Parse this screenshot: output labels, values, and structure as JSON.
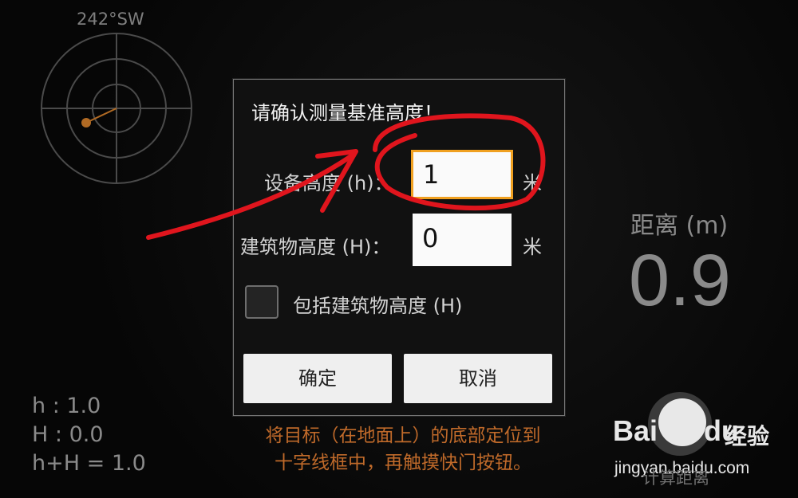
{
  "compass": {
    "heading": "242°SW"
  },
  "dialog": {
    "title": "请确认测量基准高度！",
    "device_height": {
      "label": "设备高度 (h)：",
      "value": "1",
      "unit": "米"
    },
    "building_height": {
      "label": "建筑物高度 (H)：",
      "value": "0",
      "unit": "米"
    },
    "include_building": {
      "label": "包括建筑物高度 (H)",
      "checked": false
    },
    "ok_label": "确定",
    "cancel_label": "取消"
  },
  "stats": {
    "h": "h : 1.0",
    "H": "H : 0.0",
    "sum": "h+H = 1.0"
  },
  "distance": {
    "label": "距离 (m)",
    "value": "0.9"
  },
  "instructions": {
    "line1": "将目标（在地面上）的底部定位到",
    "line2": "十字线框中，再触摸快门按钮。"
  },
  "calc_label": "计算距离",
  "watermark": {
    "brand": "Bai",
    "brand2": "du",
    "cn": "经验",
    "url": "jingyan.baidu.com"
  },
  "colors": {
    "accent_focus": "#f0a020",
    "annotation": "#e0151d",
    "instruction_text": "#c06a2a"
  }
}
